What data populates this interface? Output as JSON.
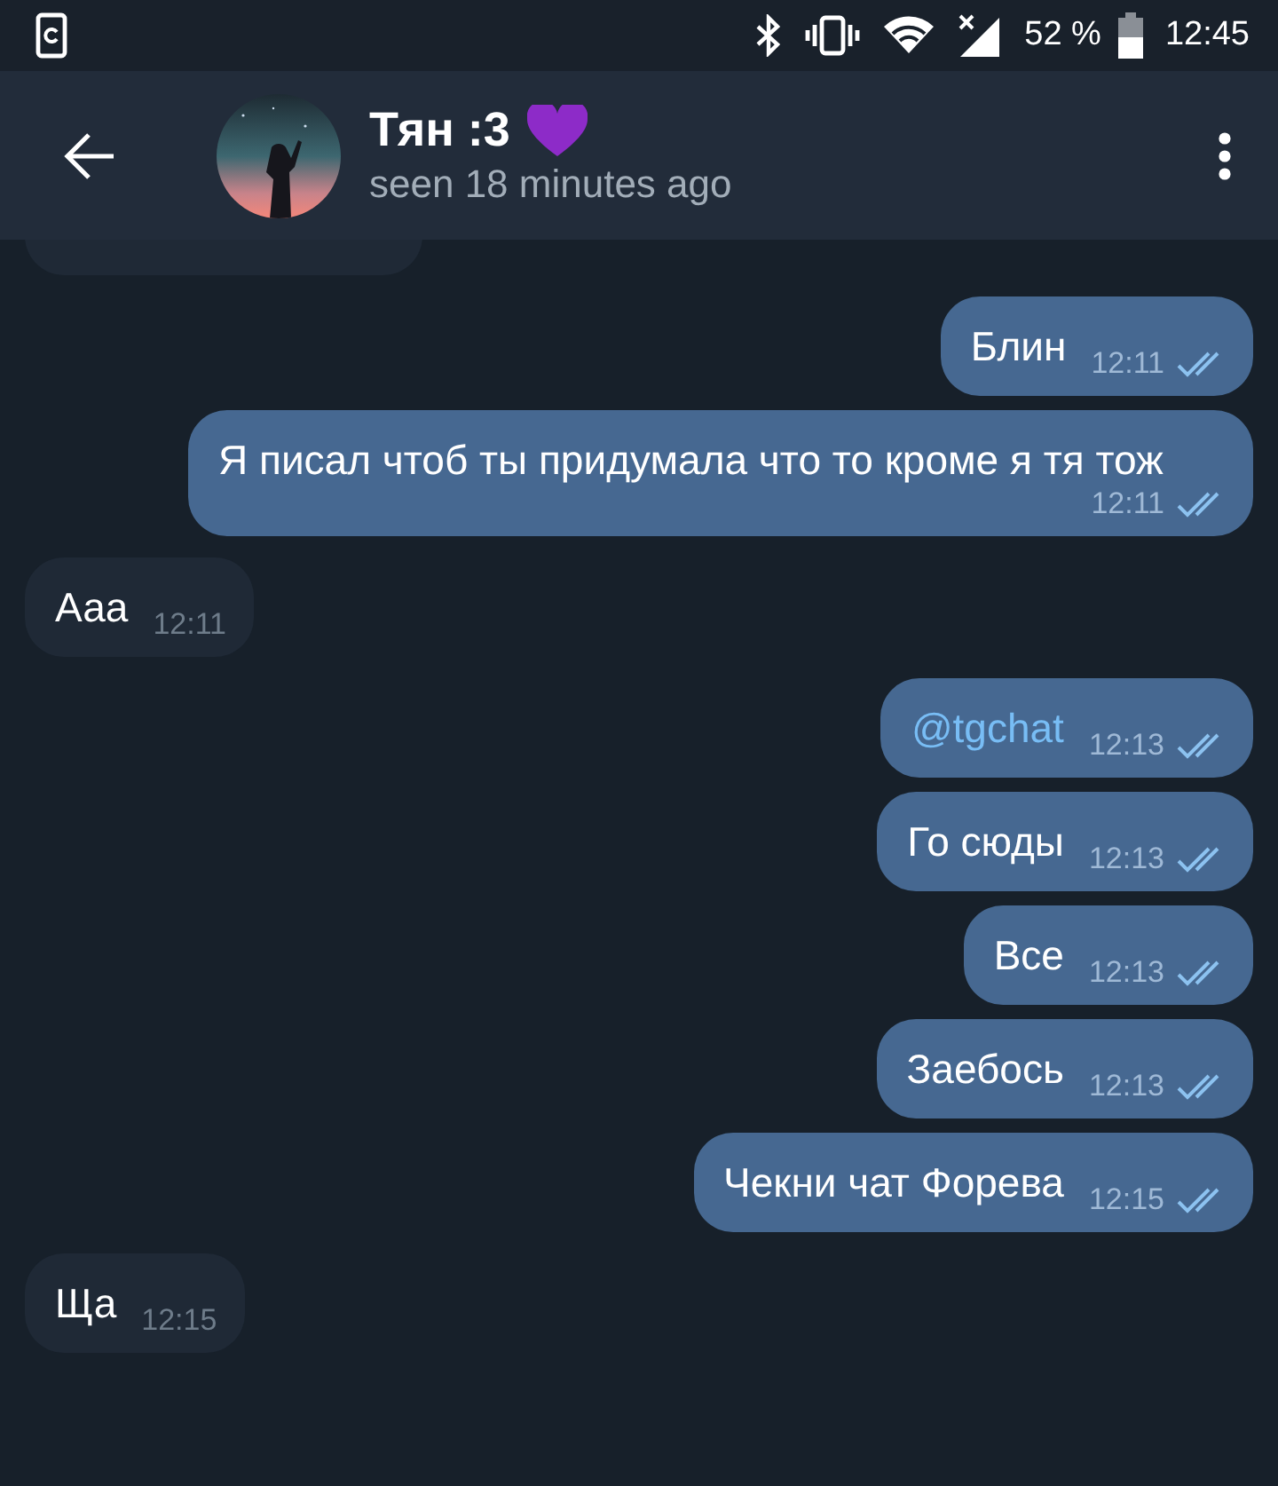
{
  "status_bar": {
    "battery": "52 %",
    "time": "12:45"
  },
  "header": {
    "title": "Тян :3",
    "status": "seen 18 minutes ago"
  },
  "messages": [
    {
      "outgoing": false,
      "kind": "cut"
    },
    {
      "outgoing": true,
      "kind": "text",
      "text": "Блин",
      "time": "12:11",
      "read": true
    },
    {
      "outgoing": true,
      "kind": "text",
      "text": "Я писал чтоб ты придумала что то кроме я тя тож",
      "time": "12:11",
      "read": true
    },
    {
      "outgoing": false,
      "kind": "text",
      "text": "Ааа",
      "time": "12:11"
    },
    {
      "outgoing": true,
      "kind": "link",
      "text": "@tgchat",
      "time": "12:13",
      "read": true
    },
    {
      "outgoing": true,
      "kind": "text",
      "text": "Го сюды",
      "time": "12:13",
      "read": true
    },
    {
      "outgoing": true,
      "kind": "text",
      "text": "Все",
      "time": "12:13",
      "read": true
    },
    {
      "outgoing": true,
      "kind": "text",
      "text": "Заебось",
      "time": "12:13",
      "read": true
    },
    {
      "outgoing": true,
      "kind": "text",
      "text": "Чекни чат Форева",
      "time": "12:15",
      "read": true
    },
    {
      "outgoing": false,
      "kind": "text",
      "text": "Ща",
      "time": "12:15"
    }
  ]
}
